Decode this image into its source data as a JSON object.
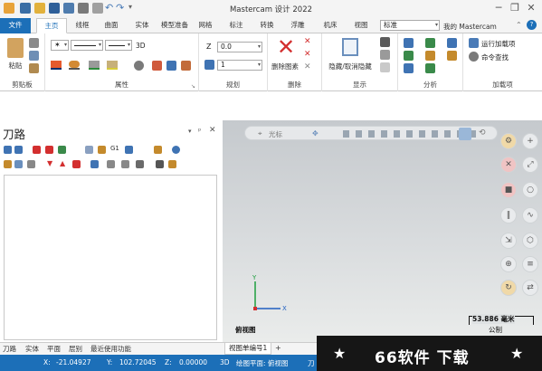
{
  "app": {
    "title": "Mastercam 设计 2022"
  },
  "tabs": [
    "文件",
    "主页",
    "线框",
    "曲面",
    "实体",
    "模型准备",
    "网格",
    "标注",
    "转换",
    "浮雕",
    "机床",
    "视图"
  ],
  "search": {
    "value": "标准",
    "account": "我的 Mastercam"
  },
  "ribbon": {
    "clipboard": {
      "paste": "粘贴",
      "group": "剪贴板"
    },
    "attributes": {
      "group": "属性",
      "dim": "3D"
    },
    "plan": {
      "z_label": "Z",
      "z_value": "0.0",
      "level_value": "1",
      "group": "规划"
    },
    "delete": {
      "button": "删除图素",
      "group": "删除"
    },
    "display": {
      "button": "隐藏/取消隐藏",
      "group": "显示"
    },
    "analysis": {
      "group": "分析"
    },
    "addins": {
      "run": "运行加载项",
      "cmd": "命令查找",
      "group": "加载项"
    }
  },
  "panel": {
    "title": "刀路"
  },
  "bottom_tabs": [
    "刀路",
    "实体",
    "平面",
    "层别",
    "最近使用功能"
  ],
  "viewport": {
    "toolbar_label": "光标",
    "view_name": "俯视图",
    "axis_y": "Y",
    "axis_x": "X",
    "scale_value": "53.886 毫米",
    "scale_unit": "公制",
    "viewsheet_tab": "视图单编号1",
    "add_tab": "+"
  },
  "banner": {
    "text": "66软件 下载",
    "star": "★"
  },
  "status": {
    "x_label": "X:",
    "x_value": "-21.04927",
    "y_label": "Y:",
    "y_value": "102.72045",
    "z_label": "Z:",
    "z_value": "0.00000",
    "mode": "3D",
    "plane": "绘图平面: 俯视图",
    "tool": "刀"
  },
  "colors": {
    "accent": "#1c6fb8",
    "delete_red": "#d32f2f",
    "banner_bg": "#161616"
  }
}
